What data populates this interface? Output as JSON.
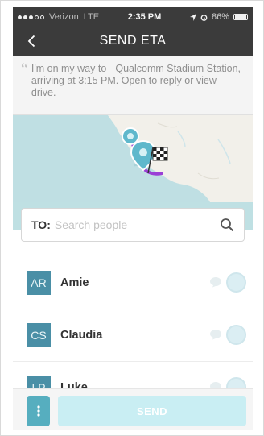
{
  "status_bar": {
    "carrier": "Verizon",
    "network": "LTE",
    "time": "2:35 PM",
    "battery": "86%",
    "battery_level": 0.86,
    "signal_strength": 3,
    "signal_max": 5,
    "location_icon": "location-arrow-icon",
    "alarm_icon": "alarm-icon"
  },
  "nav": {
    "title": "SEND ETA",
    "back_icon": "chevron-left-icon"
  },
  "message": {
    "quote_mark": "“",
    "text": "I'm on my way to - Qualcomm Stadium Station, arriving at 3:15 PM. Open to reply or view drive."
  },
  "map": {
    "start_marker": "location-pin-icon",
    "destination_marker": "checkered-flag-icon",
    "route_color": "#9b3fd6",
    "water_color": "#bfdfe3",
    "land_color": "#f2f0ea"
  },
  "search": {
    "label": "TO:",
    "placeholder": "Search people",
    "icon": "search-icon"
  },
  "contacts": [
    {
      "initials": "AR",
      "name": "Amie"
    },
    {
      "initials": "CS",
      "name": "Claudia"
    },
    {
      "initials": "LP",
      "name": "Luke"
    }
  ],
  "bottom_bar": {
    "menu_icon": "vertical-dots-icon",
    "send_label": "SEND"
  },
  "colors": {
    "header_bg": "#3b3b3b",
    "accent": "#56aebf",
    "avatar_bg": "#4a8fa6",
    "send_disabled": "#c9eef3"
  }
}
